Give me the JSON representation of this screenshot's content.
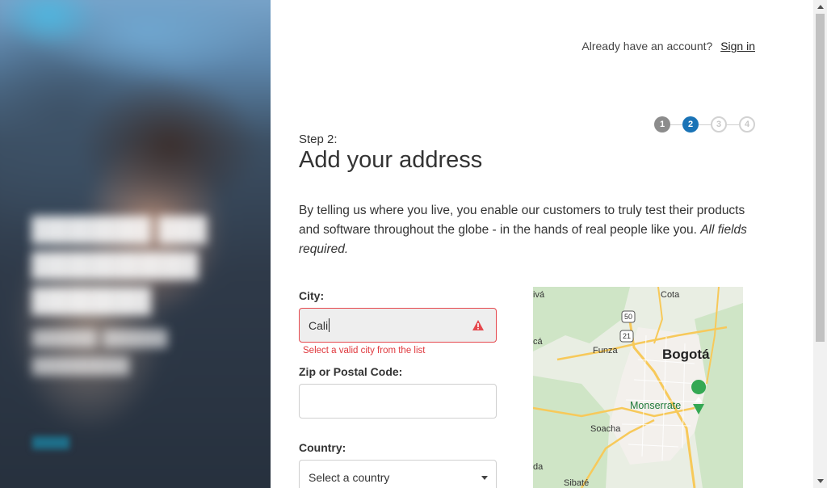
{
  "header": {
    "account_prompt": "Already have an account?",
    "signin_link": "Sign in"
  },
  "stepper": {
    "steps": [
      "1",
      "2",
      "3",
      "4"
    ],
    "current": 2
  },
  "form": {
    "step_label": "Step 2:",
    "title": "Add your address",
    "intro": "By telling us where you live, you enable our customers to truly test their products and software throughout the globe - in the hands of real people like you.",
    "intro_emphasis": "All fields required.",
    "city": {
      "label": "City:",
      "value": "Cali",
      "error": "Select a valid city from the list"
    },
    "zip": {
      "label": "Zip or Postal Code:",
      "value": ""
    },
    "country": {
      "label": "Country:",
      "selected": "Select a country"
    }
  },
  "map": {
    "labels": {
      "viva": "ivá",
      "cota": "Cota",
      "route50": "50",
      "route21": "21",
      "funza": "Funza",
      "bogota": "Bogotá",
      "monserrate": "Monserrate",
      "mosquera": "cá",
      "soacha": "Soacha",
      "sibate": "Sibaté",
      "edge": "da"
    }
  },
  "colors": {
    "accent": "#1a73b6",
    "error": "#e0383d",
    "step_done": "#8c8c8c"
  }
}
